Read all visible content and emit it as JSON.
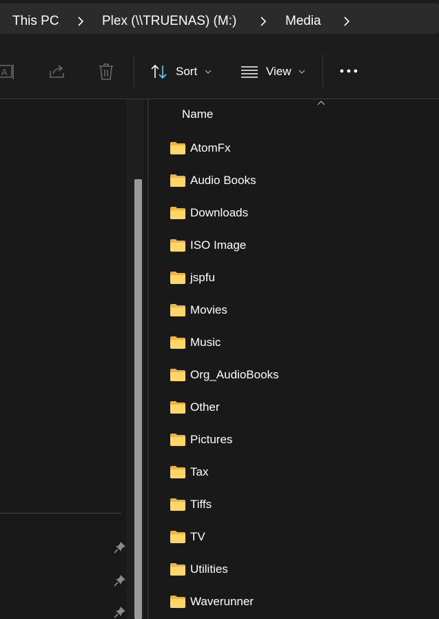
{
  "breadcrumb": {
    "items": [
      "This PC",
      "Plex (\\\\TRUENAS) (M:)",
      "Media"
    ]
  },
  "toolbar": {
    "sort_label": "Sort",
    "view_label": "View",
    "icons": [
      "rename-icon",
      "share-icon",
      "delete-icon",
      "sort-icon",
      "view-icon",
      "more-icon"
    ]
  },
  "content": {
    "column_name": "Name",
    "folders": [
      "AtomFx",
      "Audio Books",
      "Downloads",
      "ISO Image",
      "jspfu",
      "Movies",
      "Music",
      "Org_AudioBooks",
      "Other",
      "Pictures",
      "Tax",
      "Tiffs",
      "TV",
      "Utilities",
      "Waverunner"
    ]
  },
  "colors": {
    "background": "#191919",
    "folder": "#f8c954",
    "accent": "#60cdff"
  }
}
